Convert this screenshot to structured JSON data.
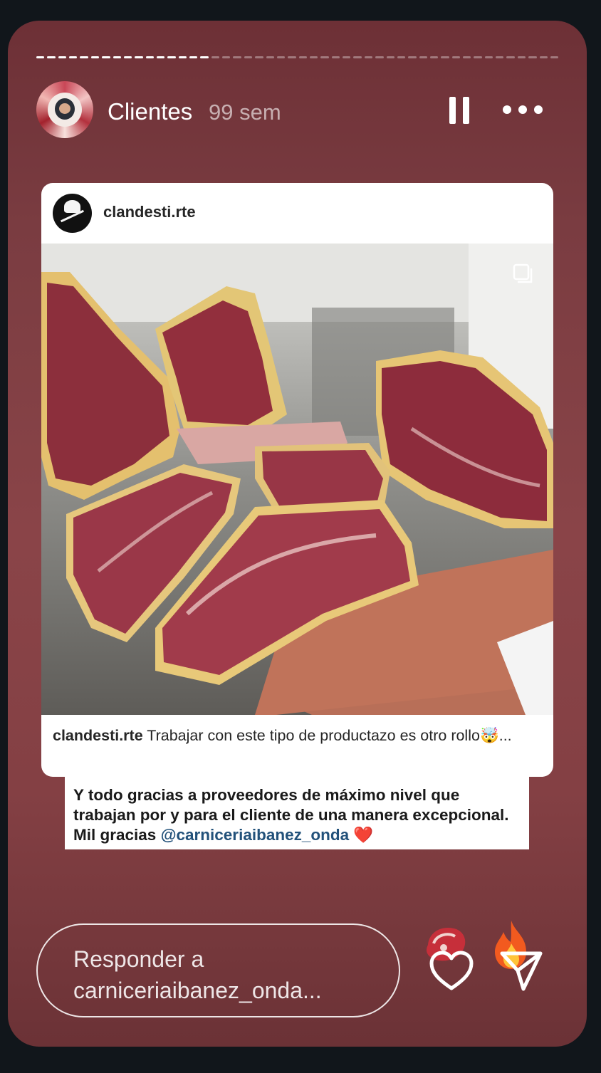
{
  "story": {
    "progress_segments": 48,
    "progress_done": 16,
    "user": {
      "name": "Clientes",
      "time": "99 sem"
    },
    "controls": {
      "pause_icon": "pause-icon",
      "more_icon": "more-icon"
    }
  },
  "shared_post": {
    "username": "clandesti.rte",
    "caption_user": "clandesti.rte",
    "caption_text": " Trabajar con este tipo de productazo es otro rollo🤯...",
    "multi_icon": "carousel-icon",
    "photo": "dry-aged beef cuts on a cutting board"
  },
  "sticker": {
    "text": "Y todo gracias a proveedores de máximo nivel que trabajan por y para el cliente de una manera excepcional. Mil gracias ",
    "mention": "@carniceriaibanez_onda",
    "emoji": " ❤️"
  },
  "footer": {
    "reply_placeholder": "Responder a carniceriaibanez_onda...",
    "meat_reaction": "meat-emoji-icon",
    "fire_reaction": "fire-emoji-icon",
    "like_icon": "heart-icon",
    "send_icon": "send-icon"
  }
}
